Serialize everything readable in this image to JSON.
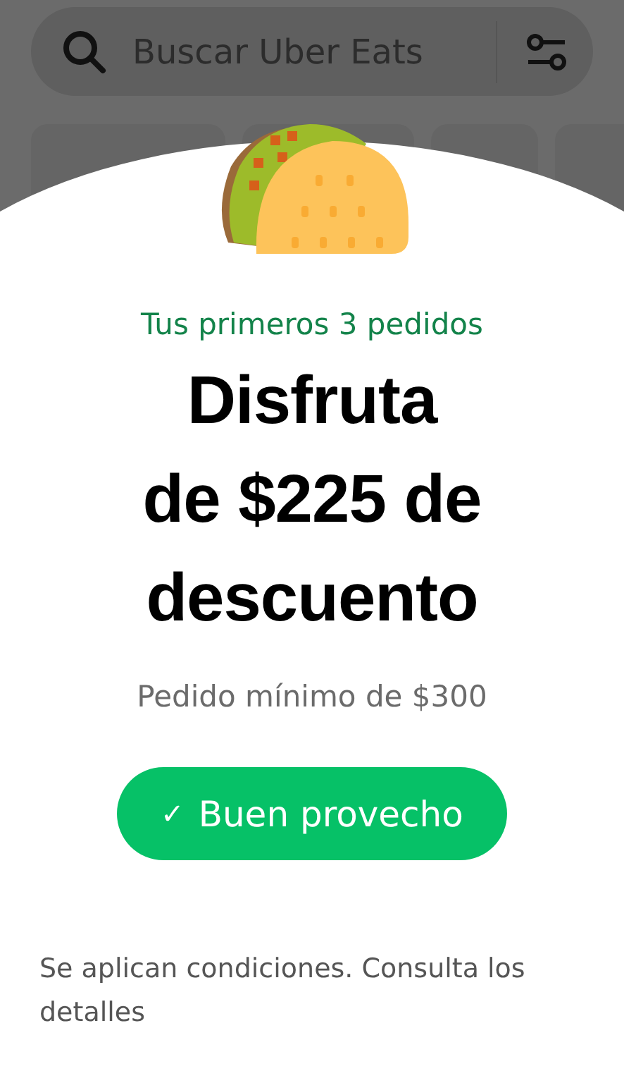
{
  "search": {
    "placeholder": "Buscar Uber Eats"
  },
  "promo": {
    "eyebrow": "Tus primeros 3 pedidos",
    "headline": [
      "Disfruta",
      "de $225 de",
      "descuento"
    ],
    "minimum": "Pedido mínimo de $300",
    "button": {
      "label": "Buen provecho",
      "icon": "✓"
    },
    "terms": "Se aplican condiciones. Consulta los detalles"
  }
}
